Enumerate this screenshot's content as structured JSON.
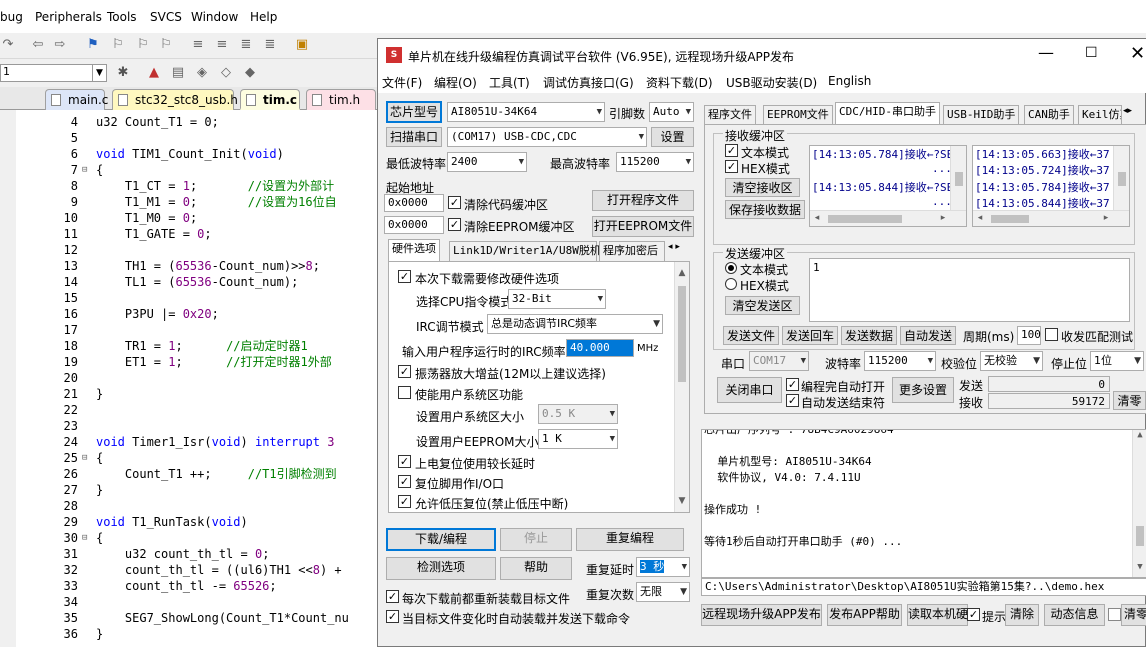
{
  "ide": {
    "menu": [
      "bug",
      "Peripherals",
      "Tools",
      "SVCS",
      "Window",
      "Help"
    ],
    "target_combo": "1",
    "tabs": [
      {
        "label": "main.c",
        "color": "#dde6f8"
      },
      {
        "label": "stc32_stc8_usb.h",
        "color": "#fff8c0"
      },
      {
        "label": "tim.c",
        "color": "#fdfde0"
      },
      {
        "label": "tim.h",
        "color": "#fde0e6"
      }
    ],
    "lines": [
      {
        "n": "4",
        "fold": "",
        "html": "u32 Count_T1 = 0;"
      },
      {
        "n": "5",
        "fold": "",
        "html": ""
      },
      {
        "n": "6",
        "fold": "",
        "html": "<span class=\"kw\">void</span> TIM1_Count_Init(<span class=\"kw\">void</span>)"
      },
      {
        "n": "7",
        "fold": "⊟",
        "html": "{"
      },
      {
        "n": "8",
        "fold": "",
        "html": "    T1_CT = <span class=\"nm\">1</span>;       <span class=\"cm\">//设置为外部计</span>"
      },
      {
        "n": "9",
        "fold": "",
        "html": "    T1_M1 = <span class=\"nm\">0</span>;       <span class=\"cm\">//设置为16位自</span>"
      },
      {
        "n": "10",
        "fold": "",
        "html": "    T1_M0 = <span class=\"nm\">0</span>;"
      },
      {
        "n": "11",
        "fold": "",
        "html": "    T1_GATE = <span class=\"nm\">0</span>;"
      },
      {
        "n": "12",
        "fold": "",
        "html": ""
      },
      {
        "n": "13",
        "fold": "",
        "html": "    TH1 = (<span class=\"nm\">65536</span>-Count_num)>><span class=\"nm\">8</span>;"
      },
      {
        "n": "14",
        "fold": "",
        "html": "    TL1 = (<span class=\"nm\">65536</span>-Count_num);"
      },
      {
        "n": "15",
        "fold": "",
        "html": ""
      },
      {
        "n": "16",
        "fold": "",
        "html": "    P3PU |= <span class=\"nm\">0x20</span>;"
      },
      {
        "n": "17",
        "fold": "",
        "html": ""
      },
      {
        "n": "18",
        "fold": "",
        "html": "    TR1 = <span class=\"nm\">1</span>;      <span class=\"cm\">//启动定时器1</span>"
      },
      {
        "n": "19",
        "fold": "",
        "html": "    ET1 = <span class=\"nm\">1</span>;      <span class=\"cm\">//打开定时器1外部</span>"
      },
      {
        "n": "20",
        "fold": "",
        "html": ""
      },
      {
        "n": "21",
        "fold": "",
        "html": "}"
      },
      {
        "n": "22",
        "fold": "",
        "html": ""
      },
      {
        "n": "23",
        "fold": "",
        "html": ""
      },
      {
        "n": "24",
        "fold": "",
        "html": "<span class=\"kw\">void</span> Timer1_Isr(<span class=\"kw\">void</span>) <span class=\"kw\">interrupt</span> <span class=\"nm\">3</span>"
      },
      {
        "n": "25",
        "fold": "⊟",
        "html": "{"
      },
      {
        "n": "26",
        "fold": "",
        "html": "    Count_T1 ++;     <span class=\"cm\">//T1引脚检测到</span>"
      },
      {
        "n": "27",
        "fold": "",
        "html": "}"
      },
      {
        "n": "28",
        "fold": "",
        "html": ""
      },
      {
        "n": "29",
        "fold": "",
        "html": "<span class=\"kw\">void</span> T1_RunTask(<span class=\"kw\">void</span>)"
      },
      {
        "n": "30",
        "fold": "⊟",
        "html": "{"
      },
      {
        "n": "31",
        "fold": "",
        "html": "    u32 count_th_tl = <span class=\"nm\">0</span>;"
      },
      {
        "n": "32",
        "fold": "",
        "html": "    count_th_tl = ((ul6)TH1 <<<span class=\"nm\">8</span>) +"
      },
      {
        "n": "33",
        "fold": "",
        "html": "    count_th_tl -= <span class=\"nm\">65526</span>;"
      },
      {
        "n": "34",
        "fold": "",
        "html": ""
      },
      {
        "n": "35",
        "fold": "",
        "html": "    SEG7_ShowLong(Count_T1*Count_nu"
      },
      {
        "n": "36",
        "fold": "",
        "html": "}"
      }
    ]
  },
  "stc": {
    "title": "单片机在线升级编程仿真调试平台软件 (V6.95E), 远程现场升级APP发布",
    "menu": [
      "文件(F)",
      "编程(O)",
      "工具(T)",
      "调试仿真接口(G)",
      "资料下载(D)",
      "USB驱动安装(D)",
      "English"
    ],
    "left": {
      "chip_btn": "芯片型号",
      "chip": "AI8051U-34K64",
      "pins_label": "引脚数",
      "pins": "Auto",
      "scan_btn": "扫描串口",
      "port": "(COM17) USB-CDC,CDC",
      "settings_btn": "设置",
      "min_baud_label": "最低波特率",
      "min_baud": "2400",
      "max_baud_label": "最高波特率",
      "max_baud": "115200",
      "start_addr_label": "起始地址",
      "addr1": "0x0000",
      "clear_code": "清除代码缓冲区",
      "open_prog_btn": "打开程序文件",
      "addr2": "0x0000",
      "clear_eeprom": "清除EEPROM缓冲区",
      "open_eeprom_btn": "打开EEPROM文件",
      "tabs": [
        "硬件选项",
        "Link1D/Writer1A/U8W脱机",
        "程序加密后"
      ],
      "options": {
        "change_hw": "本次下载需要修改硬件选项",
        "cpu_mode_label": "选择CPU指令模式",
        "cpu_mode": "32-Bit",
        "irc_mode_label": "IRC调节模式",
        "irc_mode": "总是动态调节IRC频率",
        "irc_freq_label": "输入用户程序运行时的IRC频率",
        "irc_freq": "40.000",
        "irc_unit": "MHz",
        "osc_gain": "振荡器放大增益(12M以上建议选择)",
        "user_sys": "使能用户系统区功能",
        "sys_size_label": "设置用户系统区大小",
        "sys_size": "0.5 K",
        "eeprom_size_label": "设置用户EEPROM大小",
        "eeprom_size": "1   K",
        "power_delay": "上电复位使用较长延时",
        "reset_io": "复位脚用作I/O口",
        "low_volt": "允许低压复位(禁止低压中断)"
      },
      "download_btn": "下载/编程",
      "stop_btn": "停止",
      "reprog_btn": "重复编程",
      "detect_btn": "检测选项",
      "help_btn": "帮助",
      "repeat_delay_label": "重复延时",
      "repeat_delay": "3 秒",
      "repeat_count_label": "重复次数",
      "repeat_count": "无限",
      "reload_each": "每次下载前都重新装载目标文件",
      "auto_reload": "当目标文件变化时自动装载并发送下载命令"
    },
    "right": {
      "tabs": [
        "程序文件",
        "EEPROM文件",
        "CDC/HID-串口助手",
        "USB-HID助手",
        "CAN助手",
        "Keil仿真"
      ],
      "rx_title": "接收缓冲区",
      "text_mode": "文本模式",
      "hex_mode": "HEX模式",
      "clear_rx": "清空接收区",
      "save_rx": "保存接收数据",
      "rx_left": [
        "[14:13:05.784]接收←?SE",
        "...",
        "[14:13:05.844]接收←?SE",
        "..."
      ],
      "rx_right": [
        "[14:13:05.663]接收←37 5",
        "[14:13:05.724]接收←37 5",
        "[14:13:05.784]接收←37 5",
        "[14:13:05.844]接收←37 5"
      ],
      "tx_title": "发送缓冲区",
      "tx_text": "文本模式",
      "tx_hex": "HEX模式",
      "clear_tx": "清空发送区",
      "tx_content": "1",
      "send_file": "发送文件",
      "send_enter": "发送回车",
      "send_data": "发送数据",
      "auto_send": "自动发送",
      "period_label": "周期(ms)",
      "period": "100",
      "match_test": "收发匹配测试",
      "port_label": "串口",
      "port": "COM17",
      "baud_label": "波特率",
      "baud": "115200",
      "parity_label": "校验位",
      "parity": "无校验",
      "stop_label": "停止位",
      "stop": "1位",
      "close_port": "关闭串口",
      "auto_open": "编程完自动打开",
      "auto_end": "自动发送结束符",
      "more_settings": "更多设置",
      "send_label": "发送",
      "send_count": "0",
      "recv_label": "接收",
      "recv_count": "59172",
      "clear_count": "清零"
    },
    "log": [
      "芯片出厂序列号 : 78B4C9A6029864",
      "",
      "  单片机型号: AI8051U-34K64",
      "  软件协议, V4.0: 7.4.11U",
      "",
      "操作成功 !",
      "",
      "等待1秒后自动打开串口助手 (#0) ..."
    ],
    "path": "C:\\Users\\Administrator\\Desktop\\AI8051U实验箱第15集?..\\demo.hex",
    "bottom": {
      "publish_app": "远程现场升级APP发布",
      "publish_help": "发布APP帮助",
      "read_id": "读取本机硬",
      "hint": "提示",
      "clear": "清除",
      "dynamic": "动态信息",
      "clear2": "清零"
    }
  }
}
